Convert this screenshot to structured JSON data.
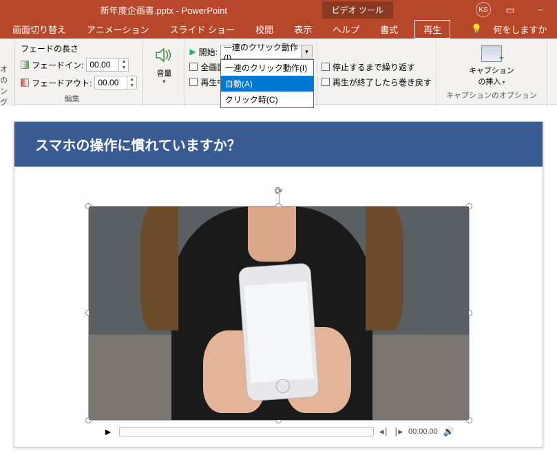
{
  "title": {
    "doc": "新年度企画書.pptx",
    "app": "PowerPoint",
    "context": "ビデオ ツール",
    "user": "KS"
  },
  "tabs": {
    "transition": "画面切り替え",
    "animation": "アニメーション",
    "slideshow": "スライド ショー",
    "review": "校閲",
    "view": "表示",
    "help": "ヘルプ",
    "format": "書式",
    "playback": "再生",
    "tellme": "何をしますか"
  },
  "ribbon": {
    "edit": "編集",
    "leftpartial1": "オの",
    "leftpartial2": "ング",
    "fade_title": "フェードの長さ",
    "fade_in": "フェードイン:",
    "fade_out": "フェードアウト:",
    "fade_in_val": "00.00",
    "fade_out_val": "00.00",
    "volume": "音量",
    "start_label": "開始:",
    "start_value": "一連のクリック動作(I)",
    "fullscreen": "全画面",
    "playing": "再生中",
    "loop": "停止するまで繰り返す",
    "rewind": "再生が終了したら巻き戻す",
    "caption_line1": "キャプション",
    "caption_line2": "の挿入",
    "caption_group": "キャプションのオプション"
  },
  "dropdown": {
    "opt1": "一連のクリック動作(I)",
    "opt2": "自動(A)",
    "opt3": "クリック時(C)"
  },
  "slide": {
    "title": "スマホの操作に慣れていますか？"
  },
  "player": {
    "time": "00:00.00"
  }
}
